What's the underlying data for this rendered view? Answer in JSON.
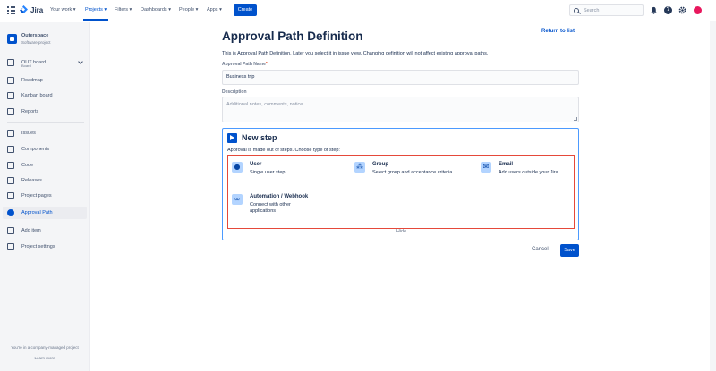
{
  "topnav": {
    "logo": "Jira",
    "items": [
      "Your work",
      "Projects",
      "Filters",
      "Dashboards",
      "People",
      "Apps"
    ],
    "active_index": 1,
    "create_label": "Create",
    "search_placeholder": "Search"
  },
  "sidebar": {
    "project_name": "Outerspace",
    "project_type": "Software project",
    "board_name": "OUT board",
    "board_sub": "Board",
    "items": [
      {
        "label": "Roadmap",
        "icon": "roadmap-icon"
      },
      {
        "label": "Kanban board",
        "icon": "board-icon"
      },
      {
        "label": "Reports",
        "icon": "reports-icon"
      },
      {
        "label": "Issues",
        "icon": "issues-icon"
      },
      {
        "label": "Components",
        "icon": "components-icon"
      },
      {
        "label": "Code",
        "icon": "code-icon"
      },
      {
        "label": "Releases",
        "icon": "releases-icon"
      },
      {
        "label": "Project pages",
        "icon": "pages-icon"
      },
      {
        "label": "Approval Path",
        "icon": "approval-icon"
      },
      {
        "label": "Add item",
        "icon": "add-icon"
      },
      {
        "label": "Project settings",
        "icon": "settings-icon"
      }
    ],
    "active_item": "Approval Path",
    "footer_text": "You're in a company-managed project",
    "footer_link": "Learn more"
  },
  "main": {
    "title": "Approval Path Definition",
    "return_link": "Return to list",
    "intro": "This is Approval Path Definition. Later you select it in issue view. Changing definition will not affect existing approval paths.",
    "name_label": "Approval Path Name",
    "name_value": "Business trip",
    "description_label": "Description",
    "description_placeholder": "Additional notes, comments, notice..."
  },
  "new_step": {
    "title": "New step",
    "description": "Approval is made out of steps. Choose type of step:",
    "options": [
      {
        "title": "User",
        "desc": "Single user step",
        "icon": "user-icon"
      },
      {
        "title": "Group",
        "desc": "Select group and acceptance criteria",
        "icon": "group-icon"
      },
      {
        "title": "Email",
        "desc": "Add users outside your Jira",
        "icon": "email-icon"
      },
      {
        "title": "Automation / Webhook",
        "desc": "Connect with other applications",
        "icon": "link-icon"
      }
    ],
    "hide_label": "Hide"
  },
  "footer": {
    "cancel": "Cancel",
    "save": "Save"
  },
  "colors": {
    "primary": "#0052cc",
    "highlight_border": "#e5493a",
    "panel_border": "#4c9aff"
  }
}
